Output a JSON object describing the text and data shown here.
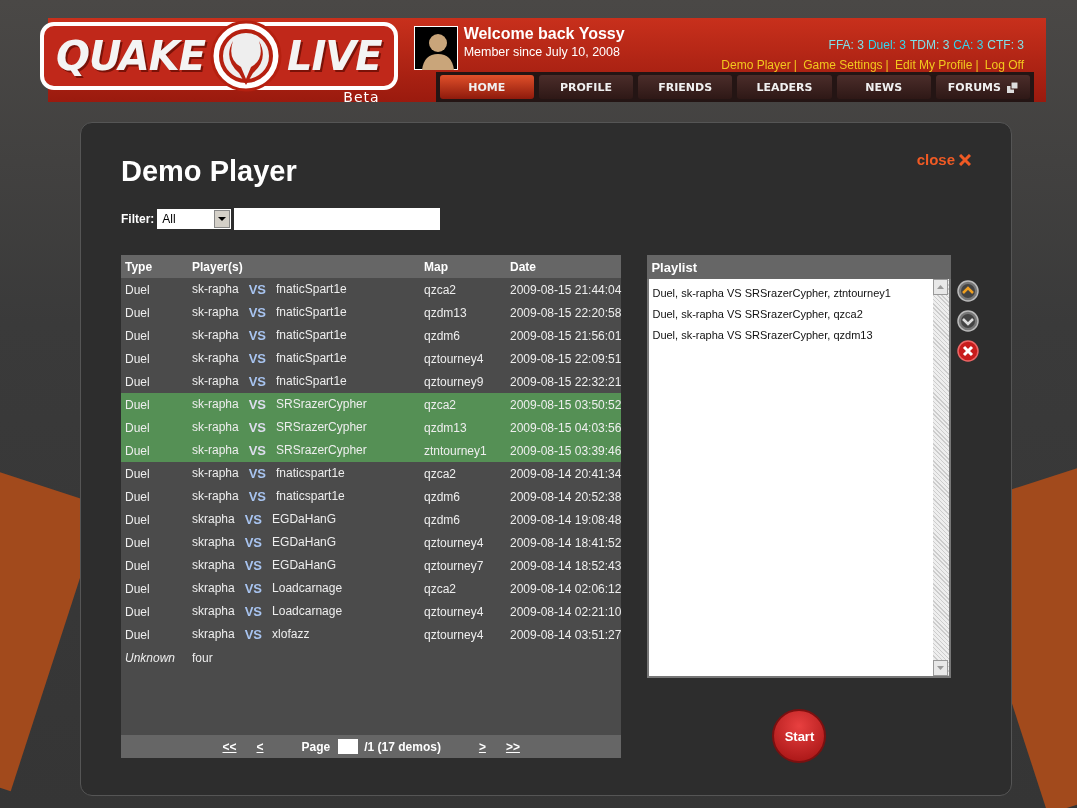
{
  "logo": {
    "left": "QUAKE",
    "right": "LIVE",
    "badge": "Beta"
  },
  "user": {
    "greeting": "Welcome back Yossy",
    "member_since": "Member since July 10, 2008"
  },
  "stats": [
    {
      "text": "FFA: 3",
      "color": "#7fe0e8"
    },
    {
      "text": "Duel: 3",
      "color": "#33d6ee"
    },
    {
      "text": "TDM: 3",
      "color": "#7fe0e8"
    },
    {
      "text": "CA: 3",
      "color": "#33d6ee"
    },
    {
      "text": "CTF: 3",
      "color": "#7fe0e8"
    }
  ],
  "user_links": [
    "Demo Player",
    "Game Settings",
    "Edit My Profile",
    "Log Off"
  ],
  "link_separator": "|",
  "nav": [
    {
      "label": "HOME",
      "selected": true,
      "external": false
    },
    {
      "label": "PROFILE",
      "selected": false,
      "external": false
    },
    {
      "label": "FRIENDS",
      "selected": false,
      "external": false
    },
    {
      "label": "LEADERS",
      "selected": false,
      "external": false
    },
    {
      "label": "NEWS",
      "selected": false,
      "external": false
    },
    {
      "label": "FORUMS",
      "selected": false,
      "external": true
    }
  ],
  "dialog": {
    "title": "Demo Player",
    "close": "close"
  },
  "filter": {
    "label": "Filter:",
    "value": "All"
  },
  "table": {
    "columns": [
      "Type",
      "Player(s)",
      "Map",
      "Date"
    ],
    "rows": [
      {
        "kind": "match",
        "type": "Duel",
        "player_1": "sk-rapha",
        "vs": "VS",
        "player_2": "fnaticSpart1e",
        "map": "qzca2",
        "date": "2009-08-15 21:44:04",
        "selected": false
      },
      {
        "kind": "match",
        "type": "Duel",
        "player_1": "sk-rapha",
        "vs": "VS",
        "player_2": "fnaticSpart1e",
        "map": "qzdm13",
        "date": "2009-08-15 22:20:58",
        "selected": false
      },
      {
        "kind": "match",
        "type": "Duel",
        "player_1": "sk-rapha",
        "vs": "VS",
        "player_2": "fnaticSpart1e",
        "map": "qzdm6",
        "date": "2009-08-15 21:56:01",
        "selected": false
      },
      {
        "kind": "match",
        "type": "Duel",
        "player_1": "sk-rapha",
        "vs": "VS",
        "player_2": "fnaticSpart1e",
        "map": "qztourney4",
        "date": "2009-08-15 22:09:51",
        "selected": false
      },
      {
        "kind": "match",
        "type": "Duel",
        "player_1": "sk-rapha",
        "vs": "VS",
        "player_2": "fnaticSpart1e",
        "map": "qztourney9",
        "date": "2009-08-15 22:32:21",
        "selected": false
      },
      {
        "kind": "match",
        "type": "Duel",
        "player_1": "sk-rapha",
        "vs": "VS",
        "player_2": "SRSrazerCypher",
        "map": "qzca2",
        "date": "2009-08-15 03:50:52",
        "selected": true
      },
      {
        "kind": "match",
        "type": "Duel",
        "player_1": "sk-rapha",
        "vs": "VS",
        "player_2": "SRSrazerCypher",
        "map": "qzdm13",
        "date": "2009-08-15 04:03:56",
        "selected": true
      },
      {
        "kind": "match",
        "type": "Duel",
        "player_1": "sk-rapha",
        "vs": "VS",
        "player_2": "SRSrazerCypher",
        "map": "ztntourney1",
        "date": "2009-08-15 03:39:46",
        "selected": true
      },
      {
        "kind": "match",
        "type": "Duel",
        "player_1": "sk-rapha",
        "vs": "VS",
        "player_2": "fnaticspart1e",
        "map": "qzca2",
        "date": "2009-08-14 20:41:34",
        "selected": false
      },
      {
        "kind": "match",
        "type": "Duel",
        "player_1": "sk-rapha",
        "vs": "VS",
        "player_2": "fnaticspart1e",
        "map": "qzdm6",
        "date": "2009-08-14 20:52:38",
        "selected": false
      },
      {
        "kind": "match",
        "type": "Duel",
        "player_1": "skrapha",
        "vs": "VS",
        "player_2": "EGDaHanG",
        "map": "qzdm6",
        "date": "2009-08-14 19:08:48",
        "selected": false
      },
      {
        "kind": "match",
        "type": "Duel",
        "player_1": "skrapha",
        "vs": "VS",
        "player_2": "EGDaHanG",
        "map": "qztourney4",
        "date": "2009-08-14 18:41:52",
        "selected": false
      },
      {
        "kind": "match",
        "type": "Duel",
        "player_1": "skrapha",
        "vs": "VS",
        "player_2": "EGDaHanG",
        "map": "qztourney7",
        "date": "2009-08-14 18:52:43",
        "selected": false
      },
      {
        "kind": "match",
        "type": "Duel",
        "player_1": "skrapha",
        "vs": "VS",
        "player_2": "Loadcarnage",
        "map": "qzca2",
        "date": "2009-08-14 02:06:12",
        "selected": false
      },
      {
        "kind": "match",
        "type": "Duel",
        "player_1": "skrapha",
        "vs": "VS",
        "player_2": "Loadcarnage",
        "map": "qztourney4",
        "date": "2009-08-14 02:21:10",
        "selected": false
      },
      {
        "kind": "match",
        "type": "Duel",
        "player_1": "skrapha",
        "vs": "VS",
        "player_2": "xlofazz",
        "map": "qztourney4",
        "date": "2009-08-14 03:51:27",
        "selected": false
      },
      {
        "kind": "unknown",
        "type": "Unknown",
        "player_1": "four",
        "selected": false
      }
    ]
  },
  "pager": {
    "first": "<<",
    "prev": "<",
    "label": "Page",
    "total": "/1 (17 demos)",
    "next": ">",
    "last": ">>"
  },
  "playlist": {
    "title": "Playlist",
    "items": [
      "Duel, sk-rapha VS SRSrazerCypher, ztntourney1",
      "Duel, sk-rapha VS SRSrazerCypher, qzca2",
      "Duel, sk-rapha VS SRSrazerCypher, qzdm13"
    ]
  },
  "start_button": "Start"
}
